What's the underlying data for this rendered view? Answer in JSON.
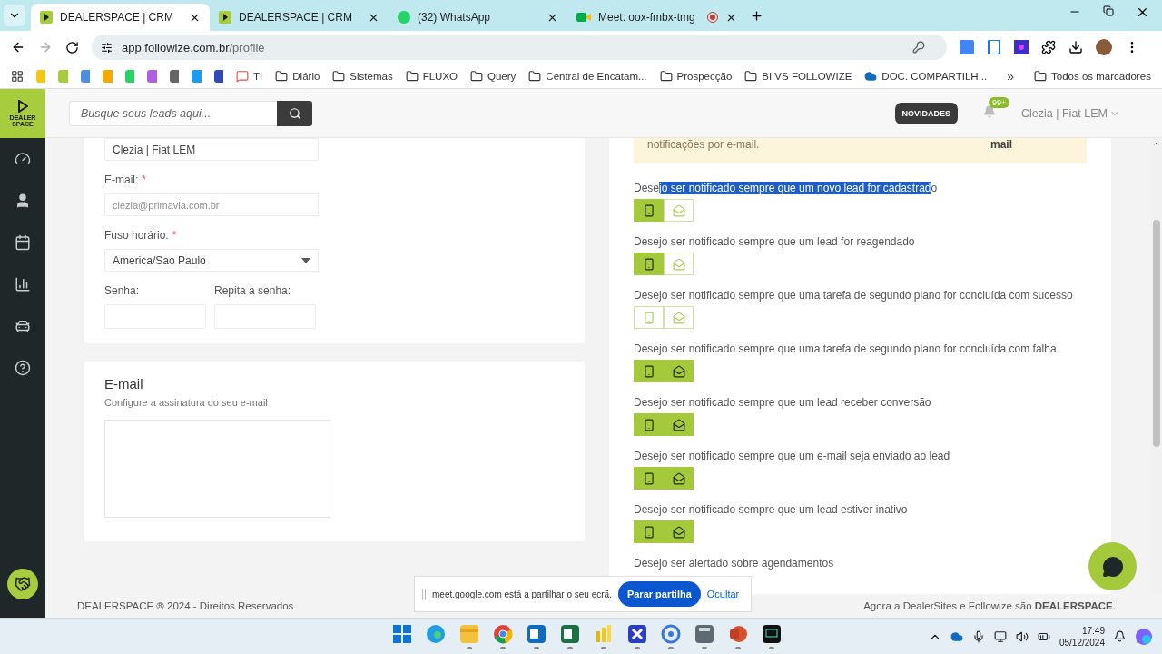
{
  "browser": {
    "tabs": [
      {
        "title": "DEALERSPACE | CRM",
        "kind": "dealerspace",
        "selected": true,
        "recording": false
      },
      {
        "title": "DEALERSPACE | CRM",
        "kind": "dealerspace",
        "selected": false,
        "recording": false
      },
      {
        "title": "(32) WhatsApp",
        "kind": "whatsapp",
        "selected": false,
        "recording": false
      },
      {
        "title": "Meet: oox-fmbx-tmg",
        "kind": "meet",
        "selected": false,
        "recording": true
      }
    ],
    "forward_disabled": true,
    "url": {
      "host": "app.followize.com.br",
      "path": "/profile"
    },
    "bookmarks": [
      {
        "label": "TI",
        "kind": "chat"
      },
      {
        "label": "Diário",
        "kind": "folder"
      },
      {
        "label": "Sistemas",
        "kind": "folder"
      },
      {
        "label": "FLUXO",
        "kind": "folder"
      },
      {
        "label": "Query",
        "kind": "folder"
      },
      {
        "label": "Central de Encatam...",
        "kind": "folder"
      },
      {
        "label": "Prospecção",
        "kind": "folder"
      },
      {
        "label": "BI VS FOLLOWIZE",
        "kind": "folder"
      },
      {
        "label": "DOC. COMPARTILH...",
        "kind": "cloud"
      }
    ],
    "more": "»",
    "all_bookmarks": "Todos os marcadores"
  },
  "app": {
    "logo": [
      "DEALER",
      "SPACE"
    ],
    "nav": [
      {
        "kind": "dashboard"
      },
      {
        "kind": "user"
      },
      {
        "kind": "calendar"
      },
      {
        "kind": "chart"
      },
      {
        "kind": "car"
      },
      {
        "kind": "help"
      }
    ],
    "search": {
      "placeholder": "Busque seus leads aqui..."
    },
    "news_button": "NOVIDADES",
    "notification_badge": "99+",
    "user": "Clezia | Fiat LEM",
    "profile": {
      "name": {
        "value": "Clezia | Fiat LEM"
      },
      "email": {
        "label": "E-mail:",
        "required_mark": "*",
        "value": "clezia@primavia.com.br",
        "disabled": true
      },
      "timezone": {
        "label": "Fuso horário:",
        "required_mark": "*",
        "value": "America/Sao Paulo"
      },
      "password": {
        "label": "Senha:"
      },
      "password_repeat": {
        "label": "Repita a senha:"
      }
    },
    "email_card": {
      "title": "E-mail",
      "subtitle": "Configure a assinatura do seu e-mail"
    },
    "notifications": {
      "alert": {
        "text": "notificações por e-mail.",
        "side_text": "mail"
      },
      "rows": [
        {
          "parts": [
            {
              "text": "Dese",
              "highlighted": false
            },
            {
              "text": "jo ser notificado sempre que um novo lead for cadastrad",
              "highlighted": true
            },
            {
              "text": "o",
              "highlighted": false
            }
          ],
          "push": true,
          "email": false
        },
        {
          "text": "Desejo ser notificado sempre que um lead for reagendado",
          "push": true,
          "email": false
        },
        {
          "text": "Desejo ser notificado sempre que uma tarefa de segundo plano for concluída com sucesso",
          "push": false,
          "email": false
        },
        {
          "text": "Desejo ser notificado sempre que uma tarefa de segundo plano for concluída com falha",
          "push": true,
          "email": true
        },
        {
          "text": "Desejo ser notificado sempre que um lead receber conversão",
          "push": true,
          "email": true
        },
        {
          "text": "Desejo ser notificado sempre que um e-mail seja enviado ao lead",
          "push": true,
          "email": true
        },
        {
          "text": "Desejo ser notificado sempre que um lead estiver inativo",
          "push": true,
          "email": true
        }
      ],
      "next_heading": "Desejo ser alertado sobre agendamentos"
    },
    "footer": {
      "left": "DEALERSPACE ® 2024 - Direitos Reservados",
      "right": "Agora a DealerSites e Followize são **DEALERSPACE**."
    }
  },
  "share_bar": {
    "message": "meet.google.com está a partilhar o seu ecrã.",
    "stop_button": "Parar partilha",
    "hide_link": "Ocultar"
  },
  "taskbar": {
    "apps": [
      {
        "kind": "start",
        "open": false
      },
      {
        "kind": "edge",
        "open": false
      },
      {
        "kind": "explorer",
        "open": true
      },
      {
        "kind": "chrome",
        "open": true
      },
      {
        "kind": "outlook",
        "open": true
      },
      {
        "kind": "excel",
        "open": true
      },
      {
        "kind": "powerbi",
        "open": true
      },
      {
        "kind": "xapp",
        "open": true
      },
      {
        "kind": "blueapp",
        "open": true
      },
      {
        "kind": "calculator",
        "open": true
      },
      {
        "kind": "powerpoint",
        "open": true
      },
      {
        "kind": "terminal",
        "open": true
      }
    ],
    "time": "17:49",
    "date": "05/12/2024"
  }
}
